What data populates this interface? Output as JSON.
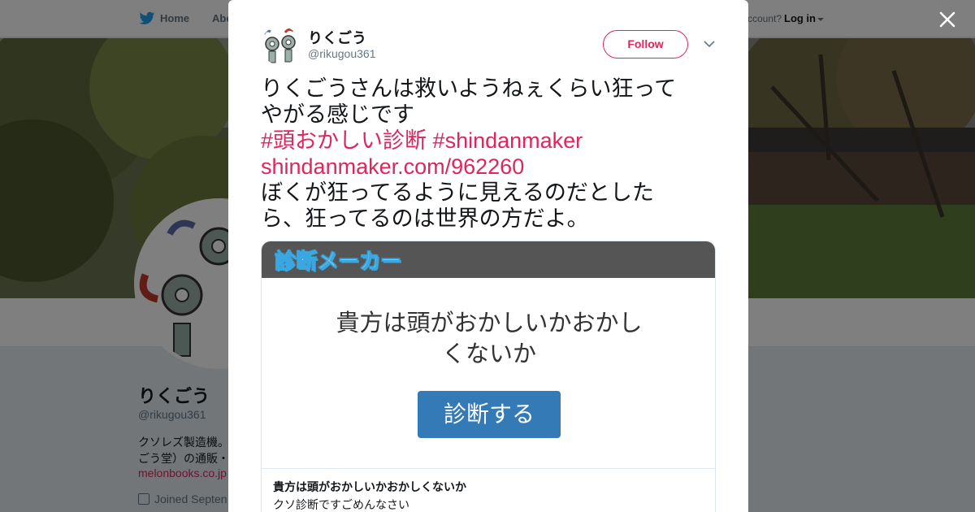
{
  "nav": {
    "home": "Home",
    "about": "Abo",
    "account_prompt": "ccount?",
    "login": "Log in"
  },
  "profile": {
    "name": "りくごう",
    "handle": "@rikugou361",
    "bio_line1": "クソレズ製造機。",
    "bio_line2": "ごう堂）の通販・",
    "link": "melonbooks.co.jp",
    "joined": "Joined Septen"
  },
  "tweet": {
    "name": "りくごう",
    "handle": "@rikugou361",
    "follow_label": "Follow",
    "text_line1": "りくごうさんは救いようねぇくらい狂って",
    "text_line2": "やがる感じです",
    "hashtag1": "#頭おかしい診断",
    "hashtag2": "#shindanmaker",
    "link": "shindanmaker.com/962260",
    "text_line3": "ぼくが狂ってるように見えるのだとした",
    "text_line4": "ら、狂ってるのは世界の方だよ。"
  },
  "card": {
    "logo": "診断メーカー",
    "question_line1": "貴方は頭がおかしいかおかし",
    "question_line2": "くないか",
    "button": "診断する",
    "title": "貴方は頭がおかしいかおかしくないか",
    "description": "クソ診断ですごめんなさい"
  },
  "colors": {
    "accent": "#e0245e",
    "twitter_blue": "#1da1f2",
    "card_button": "#337ab7"
  },
  "icons": {
    "bird": "twitter-bird-icon",
    "close": "close-icon",
    "caret": "chevron-down-icon",
    "calendar": "calendar-icon"
  }
}
